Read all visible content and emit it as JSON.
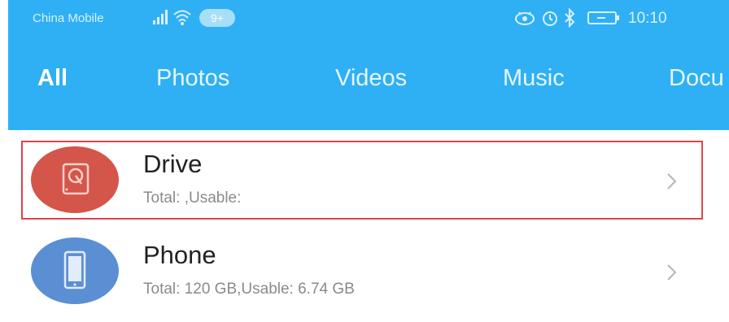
{
  "status_bar": {
    "carrier": "China Mobile",
    "notification_count": "9+",
    "time": "10:10",
    "icons": [
      "signal-icon",
      "wifi-icon",
      "eye-icon",
      "alarm-icon",
      "bluetooth-icon",
      "battery-icon"
    ]
  },
  "tabs": [
    {
      "label": "All",
      "active": true
    },
    {
      "label": "Photos",
      "active": false
    },
    {
      "label": "Videos",
      "active": false
    },
    {
      "label": "Music",
      "active": false
    },
    {
      "label": "Docu",
      "active": false
    }
  ],
  "storage": [
    {
      "name": "Drive",
      "details": "Total: ,Usable:",
      "icon": "hard-drive-icon",
      "color": "#d4554a",
      "highlighted": true
    },
    {
      "name": "Phone",
      "details": "Total: 120 GB,Usable: 6.74 GB",
      "icon": "phone-icon",
      "color": "#5b8fd4",
      "highlighted": false
    }
  ],
  "colors": {
    "header": "#2fb0f5",
    "highlight_border": "#e0434b"
  }
}
